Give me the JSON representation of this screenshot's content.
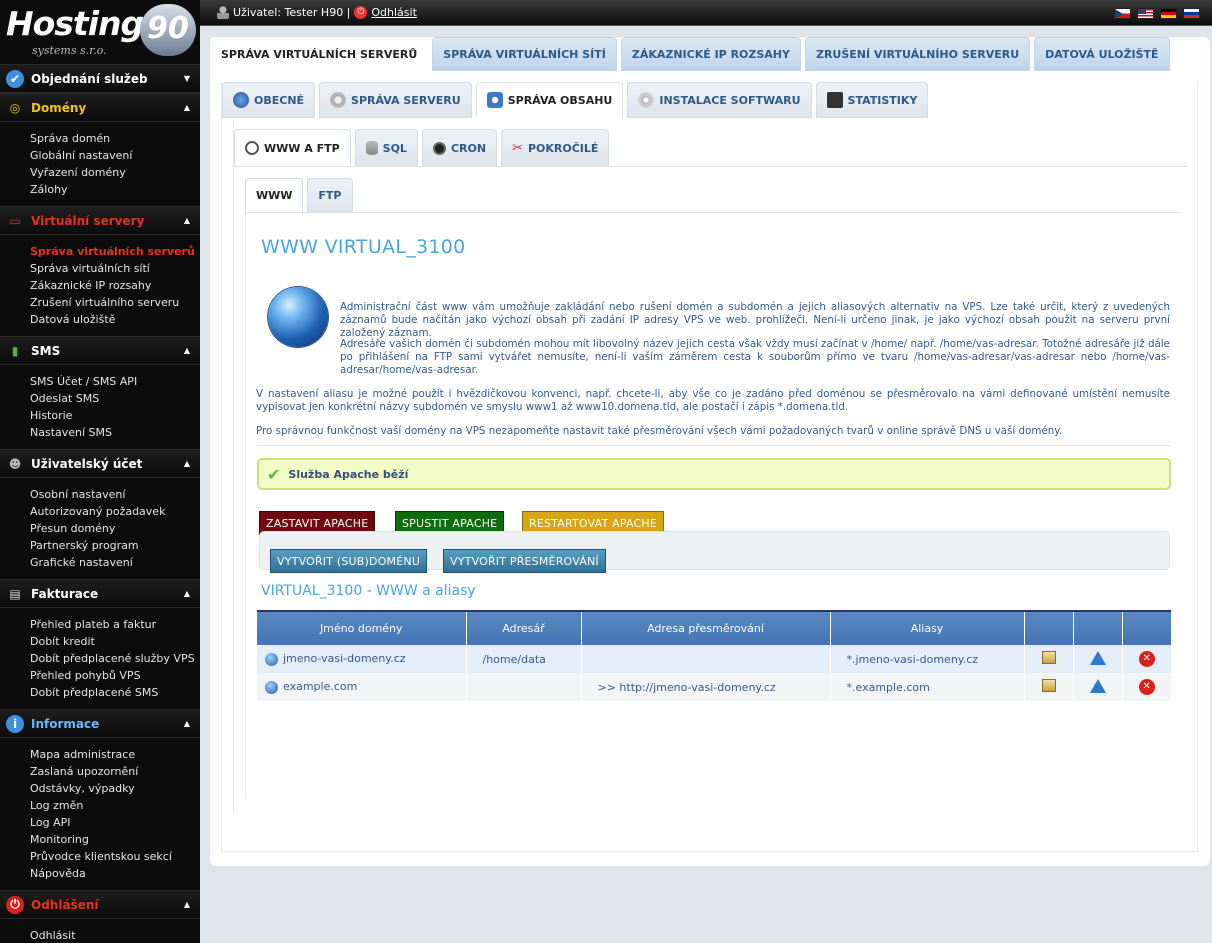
{
  "brand": {
    "logo_word": "Hosting",
    "logo_number": "90",
    "logo_sub": "systems s.r.o."
  },
  "topbar": {
    "user_label": "Uživatel: Tester H90 |",
    "logout_link": "Odhlásit",
    "flags": [
      "cs",
      "en",
      "de",
      "ru"
    ]
  },
  "sidebar": [
    {
      "title": "Objednání služeb",
      "icon": "check-circle-icon",
      "color": "white",
      "arrow": "▼",
      "items": []
    },
    {
      "title": "Domény",
      "icon": "globe-icon",
      "color": "yellow",
      "arrow": "▲",
      "items": [
        "Správa domén",
        "Globální nastavení",
        "Vyřazení domény",
        "Zálohy"
      ]
    },
    {
      "title": "Virtuální servery",
      "icon": "monitor-icon",
      "color": "red",
      "arrow": "▲",
      "items": [
        "Správa virtuálních serverů",
        "Správa virtuálních sítí",
        "Zákaznické IP rozsahy",
        "Zrušení virtuálního serveru",
        "Datová uložiště"
      ],
      "active": 0
    },
    {
      "title": "SMS",
      "icon": "phone-icon",
      "color": "white",
      "arrow": "▲",
      "items": [
        "SMS Účet / SMS API",
        "Odeslat SMS",
        "Historie",
        "Nastavení SMS"
      ]
    },
    {
      "title": "Uživatelský účet",
      "icon": "user-icon",
      "color": "white",
      "arrow": "▲",
      "items": [
        "Osobní nastavení",
        "Autorizovaný požadavek",
        "Přesun domény",
        "Partnerský program",
        "Grafické nastavení"
      ]
    },
    {
      "title": "Fakturace",
      "icon": "document-icon",
      "color": "white",
      "arrow": "▲",
      "items": [
        "Přehled plateb a faktur",
        "Dobít kredit",
        "Dobít předplacené služby VPS",
        "Přehled pohybů VPS",
        "Dobít předplacené SMS"
      ]
    },
    {
      "title": "Informace",
      "icon": "info-icon",
      "color": "blue",
      "arrow": "▲",
      "items": [
        "Mapa administrace",
        "Zaslaná upozornění",
        "Odstávky, výpadky",
        "Log změn",
        "Log API",
        "Monitoring",
        "Průvodce klientskou sekcí",
        "Nápověda"
      ]
    },
    {
      "title": "Odhlášení",
      "icon": "power-icon",
      "color": "red",
      "arrow": "▲",
      "items": [
        "Odhlásit"
      ]
    }
  ],
  "tabs_main": [
    "SPRÁVA VIRTUÁLNÍCH SERVERŮ",
    "SPRÁVA VIRTUÁLNÍCH SÍTÍ",
    "ZÁKAZNICKÉ IP ROZSAHY",
    "ZRUŠENÍ VIRTUÁLNÍHO SERVERU",
    "DATOVÁ ULOŽIŠTĚ"
  ],
  "tabs_server": [
    "OBECNÉ",
    "SPRÁVA SERVERU",
    "SPRÁVA OBSAHU",
    "INSTALACE SOFTWARU",
    "STATISTIKY"
  ],
  "tabs_content": [
    "WWW A FTP",
    "SQL",
    "CRON",
    "POKROČILÉ"
  ],
  "tabs_www": [
    "WWW",
    "FTP"
  ],
  "page": {
    "title": "WWW VIRTUAL_3100",
    "p1": "Administrační část www vám umožňuje zakládání nebo rušení domén a subdomén a jejich aliasových alternativ na VPS. Lze také určit, který z uvedených záznamů bude načítán jako výchozí obsah při zadání IP adresy VPS ve web. prohlížeči. Není-li určeno jinak, je jako výchozí obsah použit na serveru první založený záznam.",
    "p2": "Adresáře vašich domén či subdomén mohou mít libovolný název jejich cesta však vždy musí začínat v /home/ např. /home/vas-adresar. Totožné adresáře již dále po přihlášení na FTP sami vytvářet nemusíte, není-li vaším záměrem cesta k souborům přímo ve tvaru /home/vas-adresar/vas-adresar nebo /home/vas-adresar/home/vas-adresar.",
    "p3": "V nastavení aliasu je možné použít i hvězdičkovou konvenci, např. chcete-li, aby vše co je zadáno před doménou se přesměrovalo na vámi definované umístění nemusíte vypisovat jen konkrétní názvy subdomén ve smyslu www1 až www10.domena.tld, ale postačí i zápis *.domena.tld.",
    "p4": "Pro správnou funkčnost vaší domény na VPS nezapomeňte nastavit také přesměrování všech vámi požadovaných tvarů v online správě DNS u vaší domény.",
    "status": "Služba Apache běží",
    "btn_stop": "ZASTAVIT APACHE",
    "btn_start": "SPUSTIT APACHE",
    "btn_restart": "RESTARTOVAT APACHE",
    "btn_create": "VYTVOŘIT (SUB)DOMÉNU",
    "btn_redirect": "VYTVOŘIT PŘESMĚROVÁNÍ",
    "subtitle": "VIRTUAL_3100 - WWW a aliasy"
  },
  "table": {
    "headers": [
      "Jméno domény",
      "Adresář",
      "Adresa přesměrování",
      "Aliasy",
      "",
      "",
      ""
    ],
    "rows": [
      {
        "domain": "jmeno-vasi-domeny.cz",
        "dir": "/home/data",
        "redirect": "",
        "alias": "*.jmeno-vasi-domeny.cz"
      },
      {
        "domain": "example.com",
        "dir": "",
        "redirect": ">> http://jmeno-vasi-domeny.cz",
        "alias": "*.example.com"
      }
    ]
  }
}
